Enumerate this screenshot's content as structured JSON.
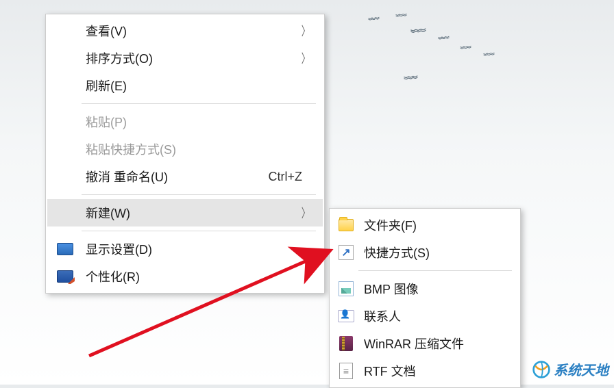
{
  "birds": [
    "~",
    "~",
    "~",
    "~",
    "~",
    "~"
  ],
  "main_menu": {
    "view": "查看(V)",
    "sort": "排序方式(O)",
    "refresh": "刷新(E)",
    "paste": "粘贴(P)",
    "paste_shortcut": "粘贴快捷方式(S)",
    "undo_rename": "撤消 重命名(U)",
    "undo_shortcut": "Ctrl+Z",
    "new": "新建(W)",
    "display_settings": "显示设置(D)",
    "personalize": "个性化(R)"
  },
  "sub_menu": {
    "folder": "文件夹(F)",
    "shortcut": "快捷方式(S)",
    "bmp": "BMP 图像",
    "contact": "联系人",
    "winrar": "WinRAR 压缩文件",
    "rtf": "RTF 文档"
  },
  "watermark": "系统天地"
}
